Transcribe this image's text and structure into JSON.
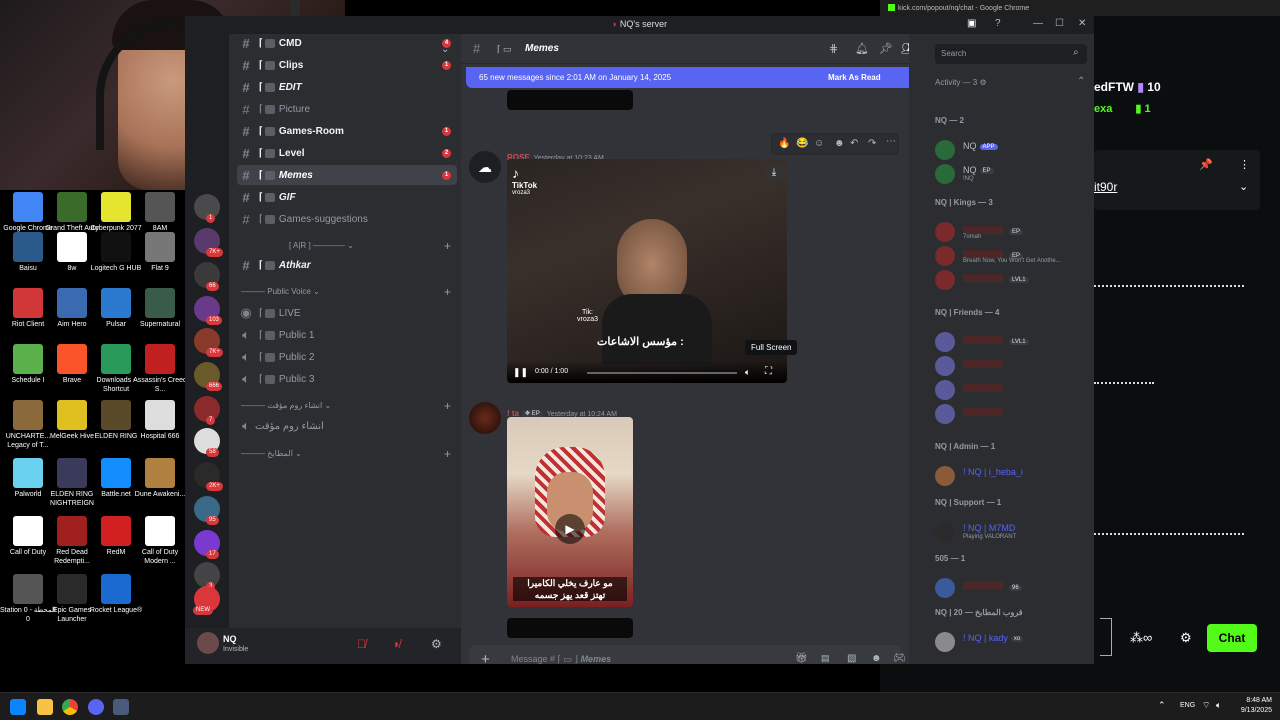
{
  "discord": {
    "window_title": "NQ's server",
    "channel_header": "Memes",
    "search_placeholder": "Search",
    "banner_text": "65 new messages since 2:01 AM on January 14, 2025",
    "banner_action": "Mark As Read",
    "composer_placeholder": "Message #",
    "composer_channel": "Memes",
    "user": {
      "name": "NQ",
      "status": "Invisible"
    },
    "channels": [
      {
        "label": "CMD",
        "bold": true,
        "badge": "4"
      },
      {
        "label": "Clips",
        "bold": true,
        "badge": "1"
      },
      {
        "label": "EDIT",
        "bold": true,
        "badge": ""
      },
      {
        "label": "Picture",
        "bold": false,
        "badge": ""
      },
      {
        "label": "Games-Room",
        "bold": true,
        "badge": "1"
      },
      {
        "label": "Level",
        "bold": true,
        "badge": "2"
      },
      {
        "label": "Memes",
        "bold": true,
        "badge": "1"
      },
      {
        "label": "GIF",
        "bold": true,
        "badge": ""
      },
      {
        "label": "Games-suggestions",
        "bold": false,
        "badge": ""
      },
      {
        "label": "A|R",
        "bold": false,
        "badge": ""
      },
      {
        "label": "Athkar",
        "bold": true,
        "badge": ""
      },
      {
        "label": "Public Voice",
        "bold": false,
        "badge": ""
      },
      {
        "label": "LIVE",
        "bold": false,
        "badge": ""
      },
      {
        "label": "Public 1",
        "bold": false,
        "badge": ""
      },
      {
        "label": "Public 2",
        "bold": false,
        "badge": ""
      },
      {
        "label": "Public 3",
        "bold": false,
        "badge": ""
      },
      {
        "label": "انشاء روم مؤقت",
        "bold": false,
        "badge": ""
      },
      {
        "label": "انشاء روم مؤقت",
        "bold": false,
        "badge": ""
      },
      {
        "label": "المطابخ",
        "bold": false,
        "badge": ""
      }
    ],
    "server_badges": [
      "1",
      "7K+",
      "66",
      "103",
      "7K+",
      "666",
      "7",
      "58",
      "2K+",
      "95",
      "17",
      "3",
      "NEW"
    ],
    "messages": [
      {
        "author": "ROSE",
        "time": "Yesterday at 10:23 AM",
        "video_time": "0:00 / 1:00",
        "tooltip": "Full Screen",
        "caption": "مؤسس الاشاعات :",
        "tiktok": "TikTok",
        "handle": "vroza3",
        "watermark_tik": "Tik:",
        "watermark_handle": "vroza3"
      },
      {
        "author": "! ta",
        "time": "Yesterday at 10:24 AM",
        "tag": "EP",
        "caption_1": "مو عارف يخلي الكاميرا",
        "caption_2": "تهتز قعد يهز جسمه"
      }
    ],
    "members": {
      "activity_header": "Activity — 3",
      "groups": [
        {
          "title": "NQ — 2",
          "items": [
            {
              "name": "NQ",
              "tag": "APP",
              "sub": ""
            },
            {
              "name": "NQ",
              "tag": "EP",
              "sub": "!NQ"
            }
          ]
        },
        {
          "title": "NQ | Kings — 3",
          "items": [
            {
              "name": "",
              "tag": "EP",
              "sub": "7omah"
            },
            {
              "name": "",
              "tag": "EP",
              "sub": "Breath Now, You Won't Get Anothe..."
            },
            {
              "name": "",
              "tag": "LVL1",
              "sub": ""
            }
          ]
        },
        {
          "title": "NQ | Friends — 4",
          "items": [
            {
              "name": "",
              "tag": "LVL1",
              "sub": ""
            },
            {
              "name": "",
              "tag": "",
              "sub": ""
            },
            {
              "name": "",
              "tag": "",
              "sub": ""
            },
            {
              "name": "",
              "tag": "",
              "sub": ""
            }
          ]
        },
        {
          "title": "NQ | Admin — 1",
          "items": [
            {
              "name": "! NQ | i_heba_i",
              "tag": "",
              "sub": ""
            }
          ]
        },
        {
          "title": "NQ | Support — 1",
          "items": [
            {
              "name": "! NQ | M7MD",
              "tag": "",
              "sub": "Playing VALORANT"
            }
          ]
        },
        {
          "title": "505 — 1",
          "items": [
            {
              "name": "",
              "tag": "96",
              "sub": ""
            }
          ]
        },
        {
          "title": "NQ | 20 — قروب المطابخ",
          "items": [
            {
              "name": "! NQ | kady",
              "tag": "xo",
              "sub": ""
            },
            {
              "name": "! NQ | Loma_141",
              "tag": "EP",
              "sub": ""
            }
          ]
        }
      ]
    }
  },
  "kick": {
    "title": "kick.com/popout/nq/chat - Google Chrome",
    "user1": "edFTW",
    "count1": "10",
    "user2": "exa",
    "count2": "1",
    "pinned_user": "it90r",
    "chat_button": "Chat"
  },
  "desktop_icons": [
    {
      "label": "Google Chrome",
      "color": "#4285f4"
    },
    {
      "label": "Grand Theft Auto V Le...",
      "color": "#3a6b2a"
    },
    {
      "label": "Cyberpunk 2077",
      "color": "#e5e52f"
    },
    {
      "label": "8AM",
      "color": "#555555"
    },
    {
      "label": "Baisu",
      "color": "#2a5a8a"
    },
    {
      "label": "8w",
      "color": "#ffffff"
    },
    {
      "label": "Logitech G HUB",
      "color": "#111111"
    },
    {
      "label": "Flat 9",
      "color": "#777777"
    },
    {
      "label": "Riot Client",
      "color": "#d13639"
    },
    {
      "label": "Aim Hero",
      "color": "#3a6ab0"
    },
    {
      "label": "Pulsar",
      "color": "#2a7ad0"
    },
    {
      "label": "Supernatural",
      "color": "#3a5a4a"
    },
    {
      "label": "Schedule I",
      "color": "#5ab04a"
    },
    {
      "label": "Brave",
      "color": "#fb542b"
    },
    {
      "label": "Downloads - Shortcut",
      "color": "#2a9a5a"
    },
    {
      "label": "Assassin's Creed S...",
      "color": "#c02020"
    },
    {
      "label": "UNCHARTE... Legacy of T...",
      "color": "#8a6a3a"
    },
    {
      "label": "MelGeek Hive",
      "color": "#e0c020"
    },
    {
      "label": "ELDEN RING",
      "color": "#5a4a2a"
    },
    {
      "label": "Hospital 666",
      "color": "#dddddd"
    },
    {
      "label": "Palworld",
      "color": "#6ad0f0"
    },
    {
      "label": "ELDEN RING NIGHTREIGN",
      "color": "#3a3a5a"
    },
    {
      "label": "Battle.net",
      "color": "#148eff"
    },
    {
      "label": "Dune Awakeni...",
      "color": "#b08040"
    },
    {
      "label": "Call of Duty",
      "color": "#ffffff"
    },
    {
      "label": "Red Dead Redempti...",
      "color": "#a02020"
    },
    {
      "label": "RedM",
      "color": "#d02020"
    },
    {
      "label": "Call of Duty Modern ...",
      "color": "#ffffff"
    },
    {
      "label": "Station 0 - المحطة 0",
      "color": "#555555"
    },
    {
      "label": "Epic Games Launcher",
      "color": "#2a2a2a"
    },
    {
      "label": "Rocket League®",
      "color": "#1a6ad0"
    }
  ],
  "taskbar": {
    "lang": "ENG",
    "time": "8:48 AM",
    "date": "9/13/2025"
  }
}
